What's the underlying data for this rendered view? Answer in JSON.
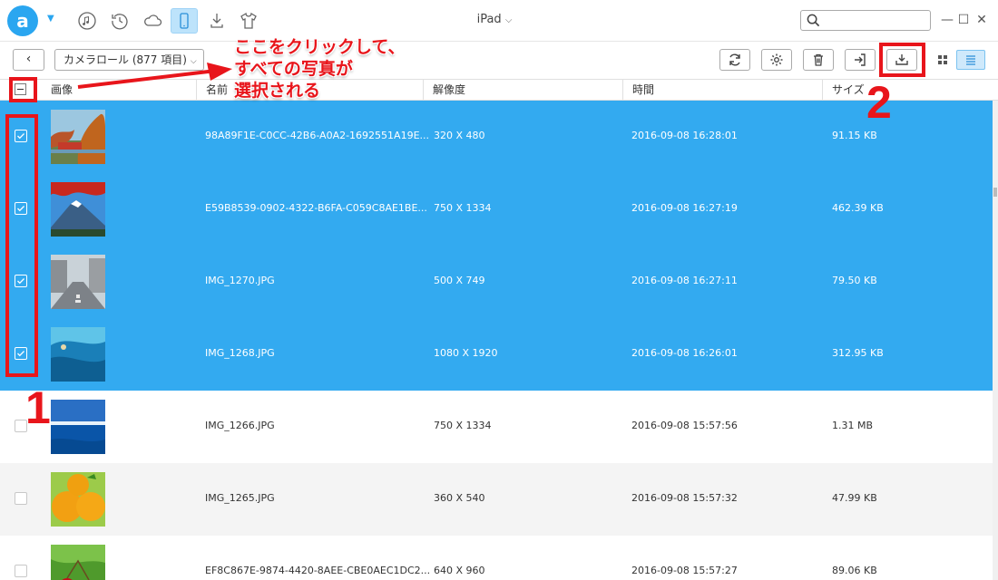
{
  "titlebar": {
    "device_name": "iPad",
    "device_caret": "⌵",
    "search_value": "",
    "search_placeholder": "",
    "logo_letter": "a",
    "icons": [
      "music-icon",
      "history-icon",
      "cloud-icon",
      "device-icon",
      "download-icon",
      "shirt-icon"
    ],
    "active_icon": "device-icon"
  },
  "toolbar": {
    "back_label": "‹",
    "album_label": "カメラロール (877 項目)",
    "album_caret": "⌵",
    "buttons": [
      "refresh-icon",
      "settings-icon",
      "trash-icon",
      "import-icon",
      "export-to-pc-icon"
    ],
    "view_modes": [
      "grid-view-icon",
      "list-view-icon"
    ],
    "active_view": "list-view-icon"
  },
  "table": {
    "columns": [
      "画像",
      "名前",
      "解像度",
      "時間",
      "サイズ"
    ],
    "rows": [
      {
        "name": "98A89F1E-C0CC-42B6-A0A2-1692551A19E...",
        "resolution": "320 X 480",
        "time": "2016-09-08 16:28:01",
        "size": "91.15 KB",
        "selected": true,
        "icloud": true,
        "thumb": "autumn-landscape"
      },
      {
        "name": "E59B8539-0902-4322-B6FA-C059C8AE1BE...",
        "resolution": "750 X 1334",
        "time": "2016-09-08 16:27:19",
        "size": "462.39 KB",
        "selected": true,
        "icloud": true,
        "thumb": "mount-fuji"
      },
      {
        "name": "IMG_1270.JPG",
        "resolution": "500 X 749",
        "time": "2016-09-08 16:27:11",
        "size": "79.50 KB",
        "selected": true,
        "icloud": false,
        "thumb": "street"
      },
      {
        "name": "IMG_1268.JPG",
        "resolution": "1080 X 1920",
        "time": "2016-09-08 16:26:01",
        "size": "312.95 KB",
        "selected": true,
        "icloud": false,
        "thumb": "water"
      },
      {
        "name": "IMG_1266.JPG",
        "resolution": "750 X 1334",
        "time": "2016-09-08 15:57:56",
        "size": "1.31 MB",
        "selected": false,
        "icloud": false,
        "thumb": "sea"
      },
      {
        "name": "IMG_1265.JPG",
        "resolution": "360 X 540",
        "time": "2016-09-08 15:57:32",
        "size": "47.99 KB",
        "selected": false,
        "icloud": false,
        "thumb": "oranges"
      },
      {
        "name": "EF8C867E-9874-4420-8AEE-CBE0AEC1DC2...",
        "resolution": "640 X 960",
        "time": "2016-09-08 15:57:27",
        "size": "89.06 KB",
        "selected": false,
        "icloud": false,
        "thumb": "cherries"
      }
    ]
  },
  "annotations": {
    "callout_lines": [
      "ここをクリックして、",
      "すべての写真が",
      "選択される"
    ],
    "step1": "1",
    "step2": "2",
    "color": "#e8151b"
  },
  "colors": {
    "selection": "#33aaf0",
    "accent": "#2aa6f0",
    "annotation": "#e8151b"
  }
}
